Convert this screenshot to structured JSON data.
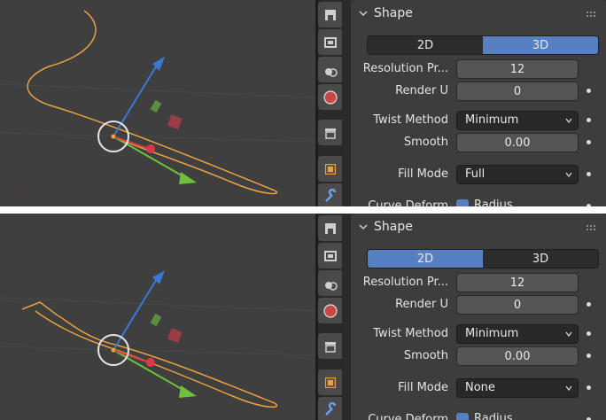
{
  "panels": [
    {
      "section_title": "Shape",
      "toggle": {
        "options": [
          "2D",
          "3D"
        ],
        "selected": "3D"
      },
      "resolution_label": "Resolution Pr...",
      "resolution_value": "12",
      "render_label": "Render U",
      "render_value": "0",
      "twist_label": "Twist Method",
      "twist_value": "Minimum",
      "smooth_label": "Smooth",
      "smooth_value": "0.00",
      "fill_label": "Fill Mode",
      "fill_value": "Full",
      "curve_label": "Curve Deform",
      "radius_label": "Radius"
    },
    {
      "section_title": "Shape",
      "toggle": {
        "options": [
          "2D",
          "3D"
        ],
        "selected": "2D"
      },
      "resolution_label": "Resolution Pr...",
      "resolution_value": "12",
      "render_label": "Render U",
      "render_value": "0",
      "twist_label": "Twist Method",
      "twist_value": "Minimum",
      "smooth_label": "Smooth",
      "smooth_value": "0.00",
      "fill_label": "Fill Mode",
      "fill_value": "None",
      "curve_label": "Curve Deform",
      "radius_label": "Radius"
    }
  ],
  "colors": {
    "viewport_bg": "#3f3f3f",
    "curve": "#e8a040",
    "accent": "#5680c2",
    "gizmo_z": "#3a78d8",
    "gizmo_y": "#6cc23a",
    "gizmo_x": "#d83a4a"
  },
  "icons": [
    "tool-icon",
    "render-icon",
    "output-icon",
    "view-layer-icon",
    "scene-icon",
    "world-icon",
    "object-icon",
    "modifier-icon"
  ]
}
